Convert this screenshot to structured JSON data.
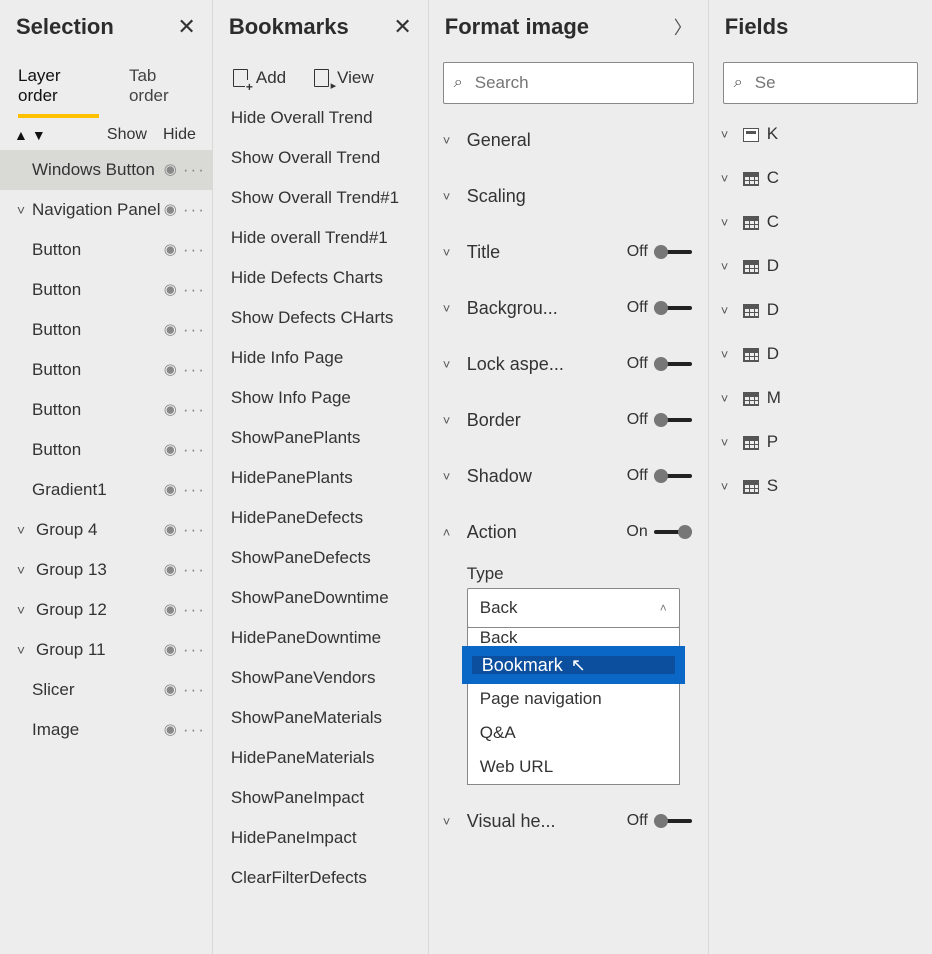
{
  "selection": {
    "title": "Selection",
    "tabs": {
      "layer": "Layer order",
      "tab": "Tab order"
    },
    "toolbar": {
      "show": "Show",
      "hide": "Hide"
    },
    "items": [
      {
        "label": "Windows Button",
        "chevron": false,
        "selected": true,
        "indent": 0
      },
      {
        "label": "Navigation Panel",
        "chevron": true,
        "selected": false,
        "indent": 0
      },
      {
        "label": "Button",
        "chevron": false,
        "selected": false,
        "indent": 0
      },
      {
        "label": "Button",
        "chevron": false,
        "selected": false,
        "indent": 0
      },
      {
        "label": "Button",
        "chevron": false,
        "selected": false,
        "indent": 0
      },
      {
        "label": "Button",
        "chevron": false,
        "selected": false,
        "indent": 0
      },
      {
        "label": "Button",
        "chevron": false,
        "selected": false,
        "indent": 0
      },
      {
        "label": "Button",
        "chevron": false,
        "selected": false,
        "indent": 0
      },
      {
        "label": "Gradient1",
        "chevron": false,
        "selected": false,
        "indent": 0
      },
      {
        "label": "Group 4",
        "chevron": true,
        "selected": false,
        "indent": 1
      },
      {
        "label": "Group 13",
        "chevron": true,
        "selected": false,
        "indent": 1
      },
      {
        "label": "Group 12",
        "chevron": true,
        "selected": false,
        "indent": 1
      },
      {
        "label": "Group 11",
        "chevron": true,
        "selected": false,
        "indent": 1
      },
      {
        "label": "Slicer",
        "chevron": false,
        "selected": false,
        "indent": 0
      },
      {
        "label": "Image",
        "chevron": false,
        "selected": false,
        "indent": 0
      }
    ]
  },
  "bookmarks": {
    "title": "Bookmarks",
    "toolbar": {
      "add": "Add",
      "view": "View"
    },
    "items": [
      "Hide Overall Trend",
      "Show Overall Trend",
      "Show Overall Trend#1",
      "Hide overall Trend#1",
      "Hide Defects Charts",
      "Show Defects CHarts",
      "Hide Info Page",
      "Show Info Page",
      "ShowPanePlants",
      "HidePanePlants",
      "HidePaneDefects",
      "ShowPaneDefects",
      "ShowPaneDowntime",
      "HidePaneDowntime",
      "ShowPaneVendors",
      "ShowPaneMaterials",
      "HidePaneMaterials",
      "ShowPaneImpact",
      "HidePaneImpact",
      "ClearFilterDefects"
    ]
  },
  "format": {
    "title": "Format image",
    "search_placeholder": "Search",
    "sections": [
      {
        "label": "General",
        "expanded": false,
        "toggle": null
      },
      {
        "label": "Scaling",
        "expanded": false,
        "toggle": null
      },
      {
        "label": "Title",
        "expanded": false,
        "toggle": "Off"
      },
      {
        "label": "Backgrou...",
        "expanded": false,
        "toggle": "Off"
      },
      {
        "label": "Lock aspe...",
        "expanded": false,
        "toggle": "Off"
      },
      {
        "label": "Border",
        "expanded": false,
        "toggle": "Off"
      },
      {
        "label": "Shadow",
        "expanded": false,
        "toggle": "Off"
      },
      {
        "label": "Action",
        "expanded": true,
        "toggle": "On"
      }
    ],
    "action": {
      "type_label": "Type",
      "type_value": "Back",
      "options": [
        "Back",
        "Bookmark",
        "Page navigation",
        "Q&A",
        "Web URL"
      ],
      "highlighted": "Bookmark"
    },
    "visual_header": {
      "label": "Visual he...",
      "toggle": "Off"
    }
  },
  "fields": {
    "title": "Fields",
    "search_placeholder": "Se",
    "tables": [
      {
        "name": "K",
        "icon": "calc"
      },
      {
        "name": "C",
        "icon": "table"
      },
      {
        "name": "C",
        "icon": "table"
      },
      {
        "name": "D",
        "icon": "table"
      },
      {
        "name": "D",
        "icon": "table"
      },
      {
        "name": "D",
        "icon": "table"
      },
      {
        "name": "M",
        "icon": "table"
      },
      {
        "name": "P",
        "icon": "table"
      },
      {
        "name": "S",
        "icon": "table"
      }
    ]
  }
}
